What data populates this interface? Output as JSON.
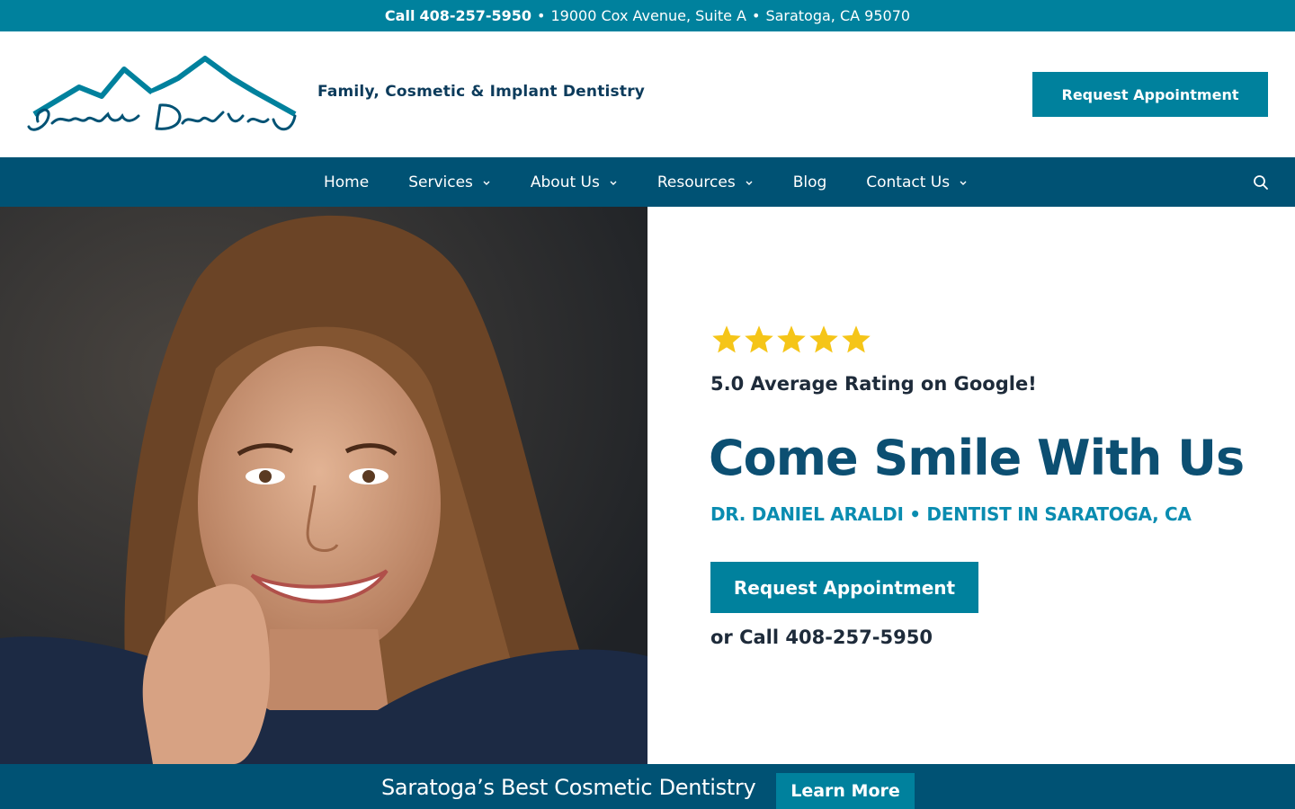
{
  "topbar": {
    "call_label": "Call",
    "phone": "408-257-5950",
    "address": "19000 Cox Avenue, Suite A",
    "city": "Saratoga, CA 95070",
    "separator": "•"
  },
  "header": {
    "logo_alt_text": "Saratoga Dentistry",
    "tagline": "Family, Cosmetic & Implant Dentistry",
    "cta_label": "Request Appointment"
  },
  "nav": {
    "items": [
      {
        "label": "Home",
        "has_dropdown": false
      },
      {
        "label": "Services",
        "has_dropdown": true
      },
      {
        "label": "About Us",
        "has_dropdown": true
      },
      {
        "label": "Resources",
        "has_dropdown": true
      },
      {
        "label": "Blog",
        "has_dropdown": false
      },
      {
        "label": "Contact Us",
        "has_dropdown": true
      }
    ],
    "search_icon": "search-icon"
  },
  "hero": {
    "rating_stars": 5,
    "rating_text": "5.0 Average Rating on Google!",
    "headline": "Come Smile With Us",
    "subhead": "DR. DANIEL ARALDI • DENTIST IN SARATOGA, CA",
    "cta_label": "Request Appointment",
    "call_text": "or Call 408-257-5950"
  },
  "banner": {
    "text": "Saratoga’s Best Cosmetic Dentistry",
    "cta_label": "Learn More"
  },
  "colors": {
    "teal": "#00819d",
    "navy": "#005274",
    "headline": "#0c4f72",
    "subhead": "#0a8cb0",
    "star": "#f5c518"
  }
}
